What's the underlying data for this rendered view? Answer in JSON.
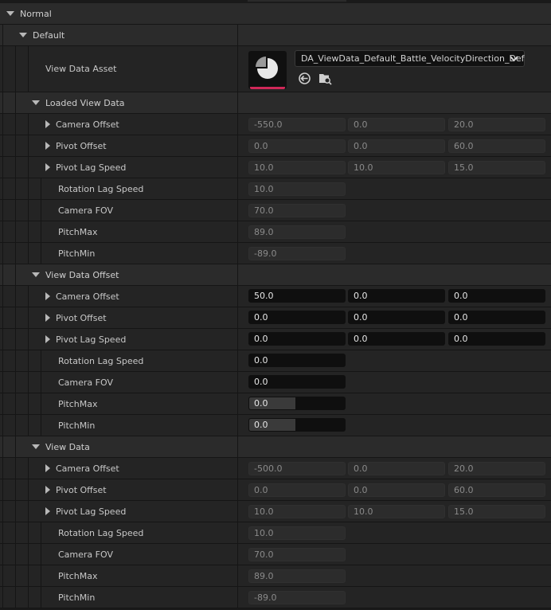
{
  "sections": {
    "normal": "Normal",
    "default": "Default",
    "loaded_view_data": "Loaded View Data",
    "view_data_offset": "View Data Offset",
    "view_data": "View Data"
  },
  "asset": {
    "label": "View Data Asset",
    "value": "DA_ViewData_Default_Battle_VelocityDirection_Def"
  },
  "loaded": {
    "camera_offset": {
      "label": "Camera Offset",
      "x": "-550.0",
      "y": "0.0",
      "z": "20.0"
    },
    "pivot_offset": {
      "label": "Pivot Offset",
      "x": "0.0",
      "y": "0.0",
      "z": "60.0"
    },
    "pivot_lag_speed": {
      "label": "Pivot Lag Speed",
      "x": "10.0",
      "y": "10.0",
      "z": "15.0"
    },
    "rotation_lag_speed": {
      "label": "Rotation Lag Speed",
      "value": "10.0"
    },
    "camera_fov": {
      "label": "Camera FOV",
      "value": "70.0"
    },
    "pitch_max": {
      "label": "PitchMax",
      "value": "89.0"
    },
    "pitch_min": {
      "label": "PitchMin",
      "value": "-89.0"
    }
  },
  "offset": {
    "camera_offset": {
      "label": "Camera Offset",
      "x": "50.0",
      "y": "0.0",
      "z": "0.0"
    },
    "pivot_offset": {
      "label": "Pivot Offset",
      "x": "0.0",
      "y": "0.0",
      "z": "0.0"
    },
    "pivot_lag_speed": {
      "label": "Pivot Lag Speed",
      "x": "0.0",
      "y": "0.0",
      "z": "0.0"
    },
    "rotation_lag_speed": {
      "label": "Rotation Lag Speed",
      "value": "0.0"
    },
    "camera_fov": {
      "label": "Camera FOV",
      "value": "0.0"
    },
    "pitch_max": {
      "label": "PitchMax",
      "value": "0.0",
      "slider_fraction": 0.48
    },
    "pitch_min": {
      "label": "PitchMin",
      "value": "0.0",
      "slider_fraction": 0.48
    }
  },
  "view": {
    "camera_offset": {
      "label": "Camera Offset",
      "x": "-500.0",
      "y": "0.0",
      "z": "20.0"
    },
    "pivot_offset": {
      "label": "Pivot Offset",
      "x": "0.0",
      "y": "0.0",
      "z": "60.0"
    },
    "pivot_lag_speed": {
      "label": "Pivot Lag Speed",
      "x": "10.0",
      "y": "10.0",
      "z": "15.0"
    },
    "rotation_lag_speed": {
      "label": "Rotation Lag Speed",
      "value": "10.0"
    },
    "camera_fov": {
      "label": "Camera FOV",
      "value": "70.0"
    },
    "pitch_max": {
      "label": "PitchMax",
      "value": "89.0"
    },
    "pitch_min": {
      "label": "PitchMin",
      "value": "-89.0"
    }
  },
  "colors": {
    "accent": "#d02858",
    "active_field": "#0f0f0f",
    "panel": "#242424"
  }
}
